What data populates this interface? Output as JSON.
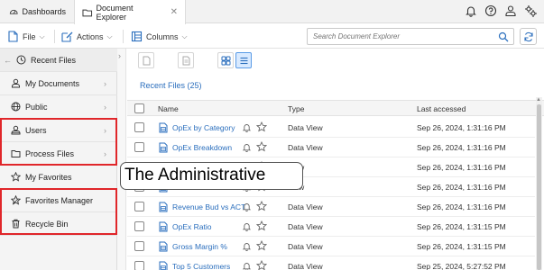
{
  "tabs": [
    {
      "label": "Dashboards",
      "icon": "dashboard-icon"
    },
    {
      "label": "Document Explorer",
      "icon": "folder-icon",
      "close": "✕"
    }
  ],
  "top_icons": [
    "bell-icon",
    "help-icon",
    "user-icon",
    "settings-icon"
  ],
  "toolbar": {
    "file_label": "File",
    "actions_label": "Actions",
    "columns_label": "Columns",
    "search_placeholder": "Search Document Explorer"
  },
  "sidebar": {
    "items": [
      {
        "label": "Recent Files",
        "icon": "clock-icon",
        "arrow": ""
      },
      {
        "label": "My Documents",
        "icon": "user-icon",
        "arrow": "›"
      },
      {
        "label": "Public",
        "icon": "globe-icon",
        "arrow": "›"
      },
      {
        "label": "Users",
        "icon": "users-icon",
        "arrow": "›"
      },
      {
        "label": "Process Files",
        "icon": "folder-icon",
        "arrow": "›"
      },
      {
        "label": "My Favorites",
        "icon": "star-icon",
        "arrow": ""
      },
      {
        "label": "Favorites Manager",
        "icon": "star-gear-icon",
        "arrow": ""
      },
      {
        "label": "Recycle Bin",
        "icon": "trash-icon",
        "arrow": ""
      }
    ]
  },
  "main": {
    "section_title": "Recent Files (25)",
    "columns": [
      "Name",
      "Type",
      "Last accessed"
    ],
    "rows": [
      {
        "name": "OpEx by Category",
        "type": "Data View",
        "date": "Sep 26, 2024, 1:31:16 PM"
      },
      {
        "name": "OpEx Breakdown",
        "type": "Data View",
        "date": "Sep 26, 2024, 1:31:16 PM"
      },
      {
        "name": "",
        "type": "View",
        "date": "Sep 26, 2024, 1:31:16 PM"
      },
      {
        "name": "",
        "type": "View",
        "date": "Sep 26, 2024, 1:31:16 PM"
      },
      {
        "name": "Revenue Bud vs ACT",
        "type": "Data View",
        "date": "Sep 26, 2024, 1:31:16 PM"
      },
      {
        "name": "OpEx Ratio",
        "type": "Data View",
        "date": "Sep 26, 2024, 1:31:15 PM"
      },
      {
        "name": "Gross Margin %",
        "type": "Data View",
        "date": "Sep 26, 2024, 1:31:15 PM"
      },
      {
        "name": "Top 5 Customers",
        "type": "Data View",
        "date": "Sep 25, 2024, 5:27:52 PM"
      }
    ]
  },
  "tooltip": "The Administrative",
  "colors": {
    "accent": "#2a6ebd",
    "highlight": "#e0262a"
  }
}
